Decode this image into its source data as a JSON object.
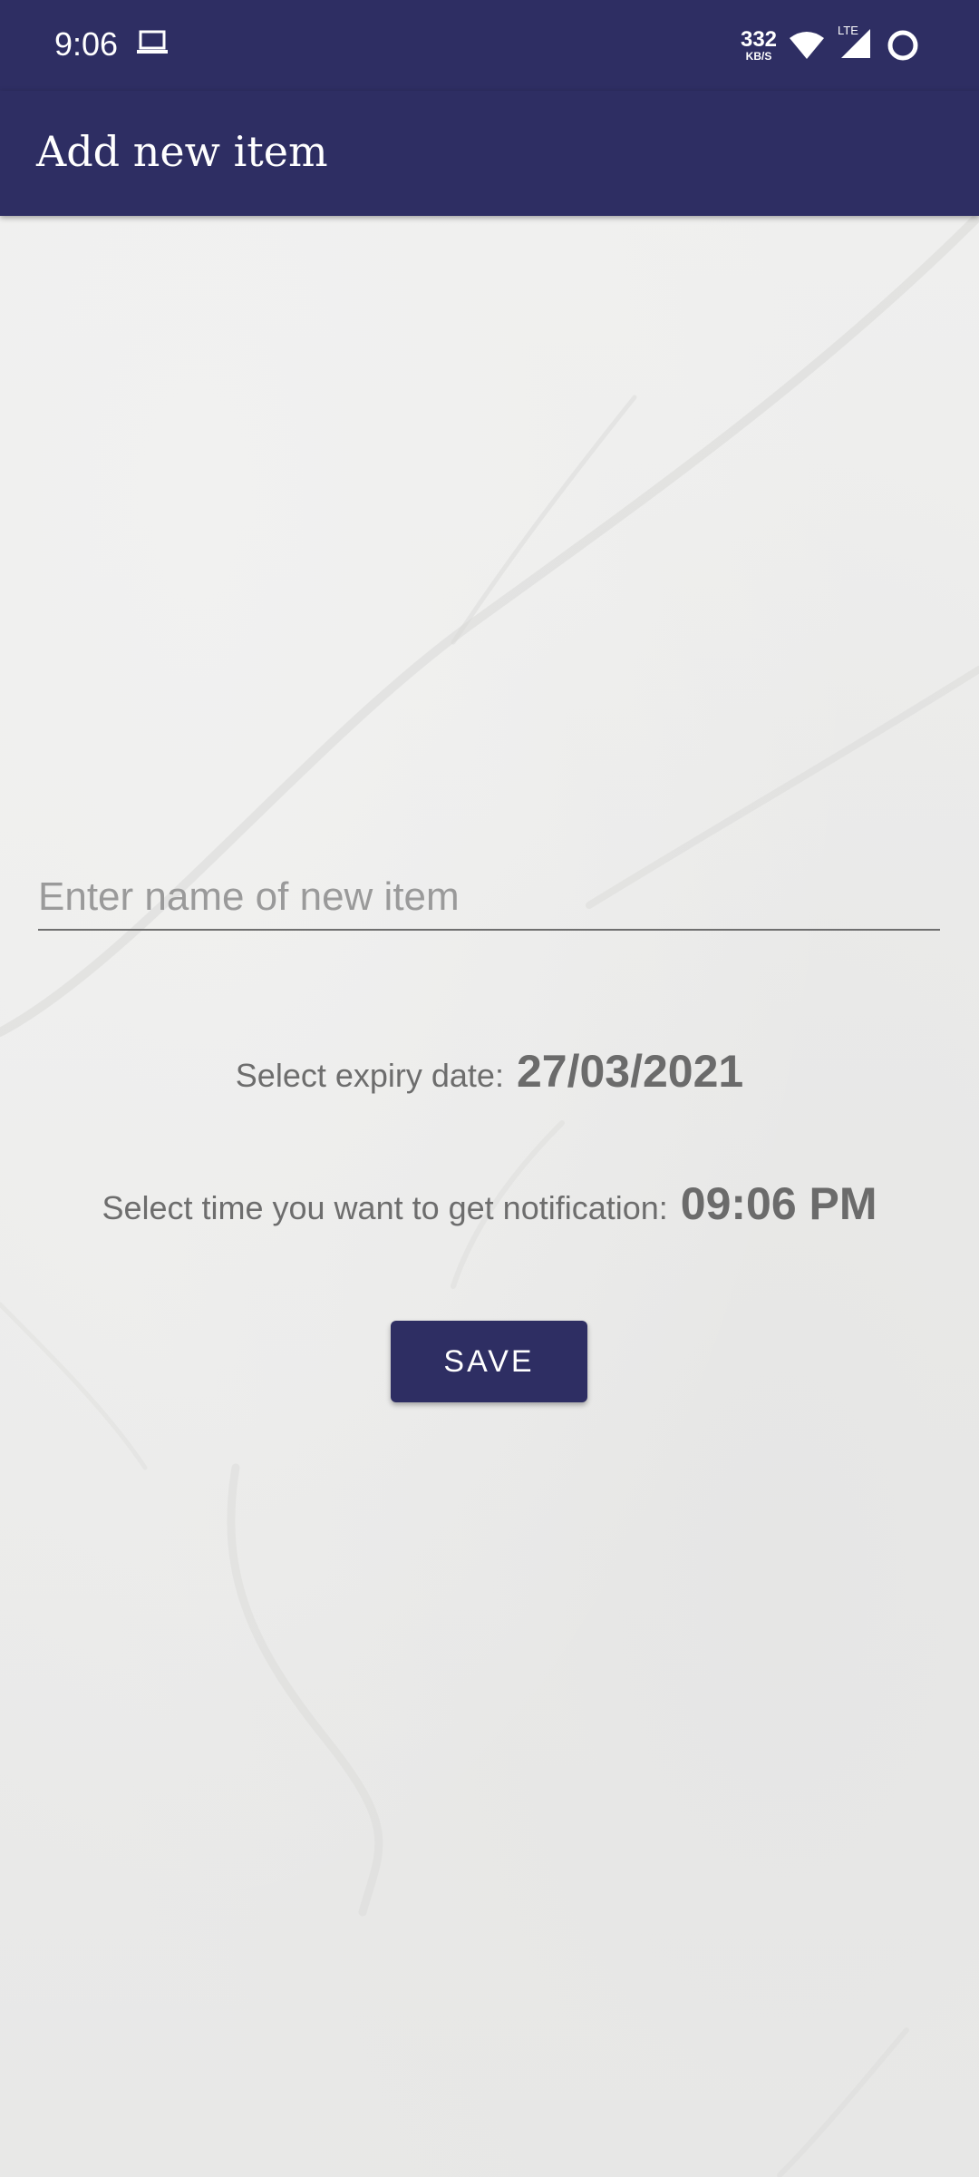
{
  "status_bar": {
    "time": "9:06",
    "net_speed_value": "332",
    "net_speed_unit": "KB/S",
    "network_type": "LTE",
    "icons": [
      "laptop-icon",
      "wifi-icon",
      "signal-icon",
      "battery-icon"
    ]
  },
  "app_bar": {
    "title": "Add new item"
  },
  "form": {
    "name_placeholder": "Enter name of new item",
    "name_value": "",
    "expiry_label": "Select expiry date:",
    "expiry_value": "27/03/2021",
    "notify_label": "Select time you want to get notification:",
    "notify_value": "09:06 PM",
    "save_label": "SAVE"
  },
  "colors": {
    "primary": "#2e2e63",
    "text_gray": "#6b6b6b",
    "background": "#ededec"
  }
}
